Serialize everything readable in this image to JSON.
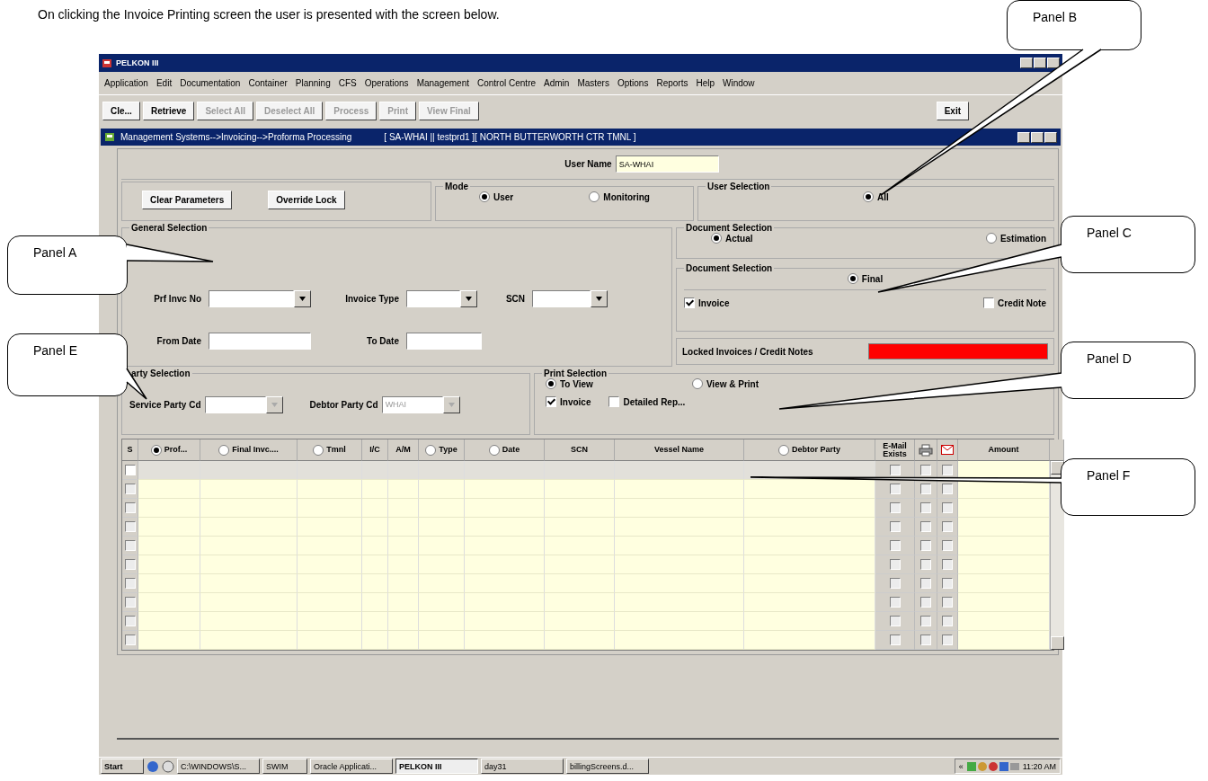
{
  "caption": "On clicking the Invoice Printing screen the user is presented with the screen below.",
  "app": {
    "title": "PELKON III",
    "menu": [
      "Application",
      "Edit",
      "Documentation",
      "Container",
      "Planning",
      "CFS",
      "Operations",
      "Management",
      "Control Centre",
      "Admin",
      "Masters",
      "Options",
      "Reports",
      "Help",
      "Window"
    ],
    "toolbar": [
      {
        "label": "Cle...",
        "disabled": false
      },
      {
        "label": "Retrieve",
        "disabled": false
      },
      {
        "label": "Select All",
        "disabled": true
      },
      {
        "label": "Deselect All",
        "disabled": true
      },
      {
        "label": "Process",
        "disabled": true
      },
      {
        "label": "Print",
        "disabled": true
      },
      {
        "label": "View Final",
        "disabled": true
      }
    ],
    "exit": "Exit",
    "form": {
      "title": "Management Systems-->Invoicing-->Proforma Processing",
      "context": "[  SA-WHAI  ||  testprd1  ][  NORTH BUTTERWORTH CTR TMNL  ]",
      "user_name": {
        "label": "User Name",
        "value": "SA-WHAI"
      },
      "buttons": [
        "Clear Parameters",
        "Override Lock"
      ],
      "mode": {
        "legend": "Mode",
        "options": [
          {
            "label": "User",
            "selected": true
          },
          {
            "label": "Monitoring",
            "selected": false
          }
        ]
      },
      "user_selection": {
        "legend": "User Selection",
        "options": [
          {
            "label": "All",
            "selected": true
          }
        ]
      },
      "general_selection": {
        "legend": "General Selection",
        "rows": [
          [
            {
              "label": "Prf Invc No",
              "kind": "lov"
            },
            {
              "label": "Invoice Type",
              "kind": "lov"
            },
            {
              "label": "SCN",
              "kind": "lov"
            }
          ],
          [
            {
              "label": "From Date",
              "kind": "text"
            },
            {
              "label": "To Date",
              "kind": "text"
            }
          ]
        ]
      },
      "document_selection": {
        "legend": "Document Selection",
        "options": [
          {
            "label": "Actual",
            "selected": true
          },
          {
            "label": "Estimation",
            "selected": false
          }
        ]
      },
      "document_selection_2": {
        "legend": "Document Selection",
        "options": [
          {
            "label": "Final",
            "selected": true
          }
        ],
        "checks": [
          {
            "label": "Invoice",
            "checked": true
          },
          {
            "label": "Credit Note",
            "checked": false
          }
        ]
      },
      "locked": {
        "label": "Locked Invoices / Credit Notes",
        "on": true
      },
      "party_selection": {
        "legend": "arty Selection",
        "fields": [
          {
            "label": "Service Party Cd",
            "disabled": true
          },
          {
            "label": "Debtor Party Cd",
            "value": "WHAI",
            "disabled": true
          }
        ]
      },
      "print_selection": {
        "legend": "Print Selection",
        "options": [
          {
            "label": "To View",
            "selected": true
          },
          {
            "label": "View & Print",
            "selected": false
          }
        ],
        "checks": [
          {
            "label": "Invoice",
            "checked": true
          },
          {
            "label": "Detailed Rep...",
            "checked": false
          }
        ]
      },
      "table": {
        "columns": [
          {
            "label": "S",
            "kind": "text"
          },
          {
            "label": "Prof...",
            "kind": "radio",
            "selected": true
          },
          {
            "label": "Final Invc....",
            "kind": "radio",
            "selected": false
          },
          {
            "label": "Tmnl",
            "kind": "radio",
            "selected": false
          },
          {
            "label": "I/C",
            "kind": "text"
          },
          {
            "label": "A/M",
            "kind": "text"
          },
          {
            "label": "Type",
            "kind": "radio",
            "selected": false
          },
          {
            "label": "Date",
            "kind": "radio",
            "selected": false
          },
          {
            "label": "SCN",
            "kind": "text"
          },
          {
            "label": "Vessel Name",
            "kind": "text"
          },
          {
            "label": "Debtor Party",
            "kind": "radio",
            "selected": false
          },
          {
            "label": "E-Mail Exists",
            "kind": "text"
          },
          {
            "kind": "printer"
          },
          {
            "kind": "mail"
          },
          {
            "label": "Amount",
            "kind": "text"
          }
        ],
        "rows": [
          {
            "current": true,
            "checked": false,
            "email": false,
            "print": false,
            "mail": false
          },
          {
            "current": false,
            "checked": false,
            "email": false,
            "print": false,
            "mail": false
          },
          {
            "current": false,
            "checked": false,
            "email": false,
            "print": false,
            "mail": false
          },
          {
            "current": false,
            "checked": false,
            "email": false,
            "print": false,
            "mail": false
          },
          {
            "current": false,
            "checked": false,
            "email": false,
            "print": false,
            "mail": false
          },
          {
            "current": false,
            "checked": false,
            "email": false,
            "print": false,
            "mail": false
          },
          {
            "current": false,
            "checked": false,
            "email": false,
            "print": false,
            "mail": false
          },
          {
            "current": false,
            "checked": false,
            "email": false,
            "print": false,
            "mail": false
          },
          {
            "current": false,
            "checked": false,
            "email": false,
            "print": false,
            "mail": false
          },
          {
            "current": false,
            "checked": false,
            "email": false,
            "print": false,
            "mail": false
          }
        ]
      }
    },
    "taskbar": {
      "start": "Start",
      "items": [
        {
          "label": "C:\\WINDOWS\\S...",
          "active": false
        },
        {
          "label": "SWIM",
          "active": false
        },
        {
          "label": "Oracle Applicati...",
          "active": false
        },
        {
          "label": "PELKON III",
          "active": true
        },
        {
          "label": "day31",
          "active": false
        },
        {
          "label": "billingScreens.d...",
          "active": false
        }
      ],
      "tray_chevron": "«",
      "time": "11:20 AM"
    }
  },
  "callouts": [
    {
      "label": "Panel B"
    },
    {
      "label": "Panel A"
    },
    {
      "label": "Panel C"
    },
    {
      "label": "Panel E"
    },
    {
      "label": "Panel D"
    },
    {
      "label": "Panel F"
    }
  ]
}
